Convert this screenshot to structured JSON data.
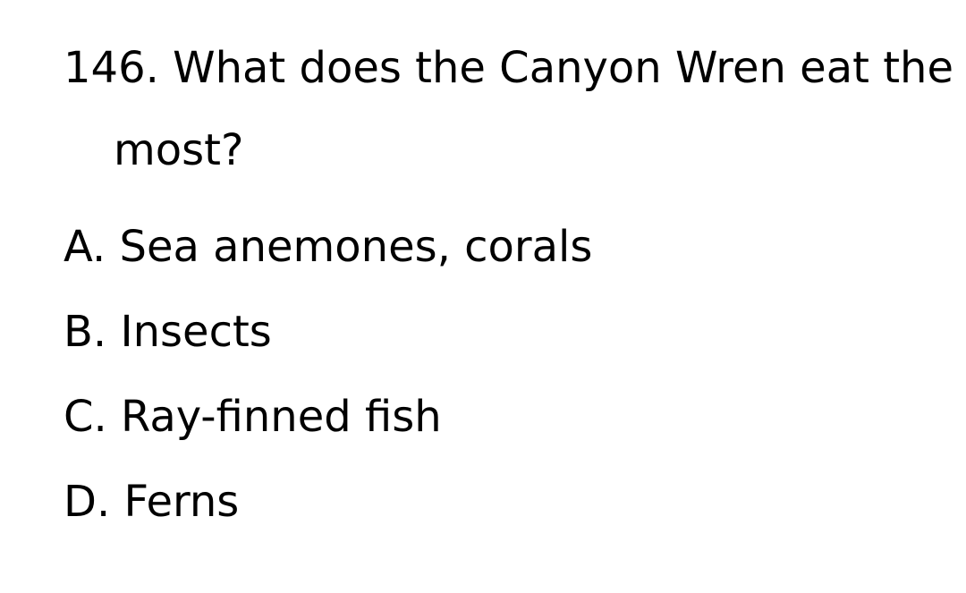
{
  "question": {
    "text": "146. What does the Canyon Wren eat the most?"
  },
  "options": [
    {
      "text": "A. Sea anemones, corals"
    },
    {
      "text": "B. Insects"
    },
    {
      "text": "C. Ray-finned fish"
    },
    {
      "text": "D. Ferns"
    }
  ]
}
